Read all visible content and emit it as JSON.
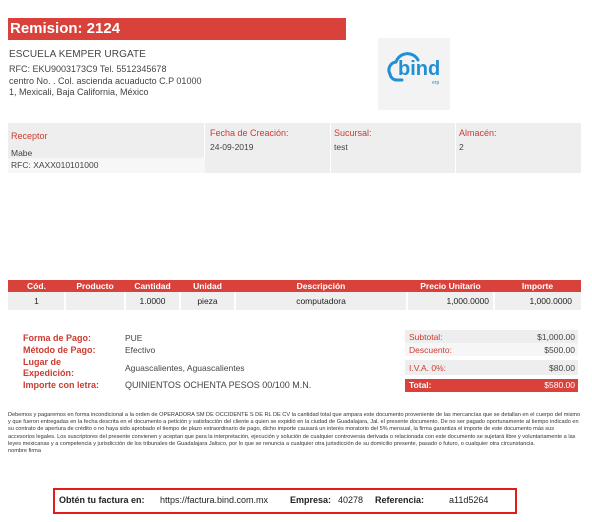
{
  "header": {
    "title": "Remision: 2124"
  },
  "company": {
    "name": "ESCUELA KEMPER URGATE",
    "rfc_line": "RFC: EKU9003173C9 Tel. 5512345678",
    "address_line": "centro No. . Col. ascienda acuaducto C.P 01000",
    "city_line": "1, Mexicali, Baja California, México"
  },
  "logo": {
    "text": "bind",
    "subtext": "erp",
    "icon": "cloud-logo-icon",
    "color": "#1f8fd6"
  },
  "info": {
    "receptor_label": "Receptor",
    "receptor_name": "Mabe",
    "receptor_rfc": "RFC: XAXX010101000",
    "fecha_label": "Fecha de Creación:",
    "fecha_value": "24-09-2019",
    "sucursal_label": "Sucursal:",
    "sucursal_value": "test",
    "almacen_label": "Almacén:",
    "almacen_value": "2"
  },
  "table": {
    "headers": [
      "Cód.",
      "Producto",
      "Cantidad",
      "Unidad",
      "Descripción",
      "Precio Unitario",
      "Importe"
    ],
    "rows": [
      [
        "1",
        "",
        "1.0000",
        "pieza",
        "computadora",
        "1,000.0000",
        "1,000.0000"
      ]
    ]
  },
  "payment": {
    "forma_label": "Forma de Pago:",
    "forma_value": "PUE",
    "metodo_label": "Método de Pago:",
    "metodo_value": "Efectivo",
    "lugar_label_1": "Lugar de",
    "lugar_label_2": "Expedición:",
    "lugar_value": "Aguascalientes, Aguascalientes",
    "importe_label": "Importe con letra:",
    "importe_value": "QUINIENTOS OCHENTA PESOS 00/100 M.N."
  },
  "totals": {
    "subtotal_label": "Subtotal:",
    "subtotal_value": "$1,000.00",
    "descuento_label": "Descuento:",
    "descuento_value": "$500.00",
    "iva_label": "I.V.A. 0%:",
    "iva_value": "$80.00",
    "total_label": "Total:",
    "total_value": "$580.00"
  },
  "legal": {
    "text": "Debemos y pagaremos en forma incondicional a la orden de OPERADORA SM DE OCCIDENTE S DE RL DE CV la cantidad total que ampara este documento proveniente de las mercancías que se detallan en el cuerpo del mismo y que fueron entregadas en la fecha descrita en el documento a petición y satisfacción del cliente a quien se expidió en la ciudad de Guadalajara, Jal. el presente documento. De no ser pagado oportunamente al tiempo indicado en su contrato de apertura de crédito o no haya sido aprobado el tiempo de plazo extraordinario de pago, dicho importe causará un interés moratorio del 5% mensual, la firma garantiza el importe de este documento más sus accesorios legales. Los suscriptores del presente convienen y aceptan que para la interpretación, ejecución y solución de cualquier controversia derivada o relacionada con este documento se sujetará libre y voluntariamente a las leyes mexicanas y a competencia y jurisdicción de los tribunales de Guadalajara Jalisco, por lo que se renuncia a cualquier otra jurisdicción de su domicilio presente, pasado o futuro, o cualquier otra circunstancia.",
    "signature_line": "nombre firma"
  },
  "footer": {
    "obten_label": "Obtén tu factura en:",
    "url": "https://factura.bind.com.mx",
    "empresa_label": "Empresa:",
    "empresa_value": "40278",
    "referencia_label": "Referencia:",
    "referencia_value": "a11d5264"
  },
  "colors": {
    "accent": "#d9423b",
    "highlight_border": "#e21b1b",
    "panel_gray": "#eeeeee"
  }
}
